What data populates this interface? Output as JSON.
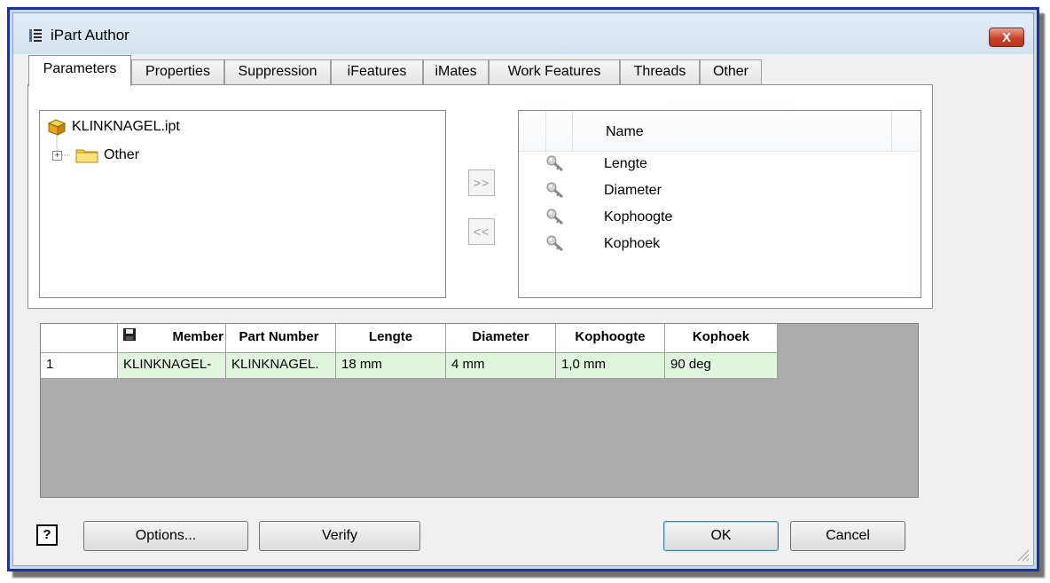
{
  "window": {
    "title": "iPart Author",
    "close_symbol": "X"
  },
  "tabs": [
    {
      "label": "Parameters"
    },
    {
      "label": "Properties"
    },
    {
      "label": "Suppression"
    },
    {
      "label": "iFeatures"
    },
    {
      "label": "iMates"
    },
    {
      "label": "Work Features"
    },
    {
      "label": "Threads"
    },
    {
      "label": "Other"
    }
  ],
  "tree": {
    "root_label": "KLINKNAGEL.ipt",
    "folder_label": "Other",
    "expander": "+"
  },
  "arrows": {
    "add": ">>",
    "remove": "<<"
  },
  "selected_params": {
    "header": "Name",
    "items": [
      {
        "label": "Lengte",
        "icon": "key-icon"
      },
      {
        "label": "Diameter",
        "icon": "key-icon"
      },
      {
        "label": "Kophoogte",
        "icon": "key-icon"
      },
      {
        "label": "Kophoek",
        "icon": "key-icon"
      }
    ]
  },
  "table": {
    "headers": [
      "Member",
      "Part Number",
      "Lengte",
      "Diameter",
      "Kophoogte",
      "Kophoek"
    ],
    "rows": [
      {
        "row_num": "1",
        "cells": [
          "KLINKNAGEL-",
          "KLINKNAGEL.",
          "18 mm",
          "4 mm",
          "1,0 mm",
          "90 deg"
        ]
      }
    ]
  },
  "buttons": {
    "help": "?",
    "options": "Options...",
    "verify": "Verify",
    "ok": "OK",
    "cancel": "Cancel"
  },
  "colors": {
    "frame_border": "#1f2fa6",
    "titlebar": "#dbe6f3",
    "close_red": "#c8432b",
    "row_green": "#dff5dc"
  }
}
